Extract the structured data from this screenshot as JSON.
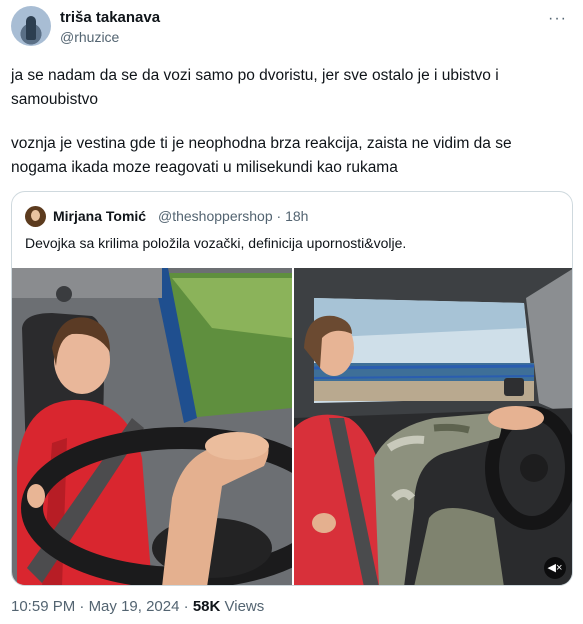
{
  "tweet": {
    "author_name": "triša takanava",
    "author_handle": "@rhuzice",
    "paragraphs": [
      "ja se nadam da se da vozi samo po dvoristu, jer sve ostalo je i ubistvo i samoubistvo",
      "voznja je vestina gde ti je neophodna brza reakcija, zaista ne vidim da se nogama ikada moze reagovati u milisekundi kao rukama"
    ],
    "more_icon": "more-horizontal-icon",
    "time": "10:59 PM",
    "separator": "·",
    "date": "May 19, 2024",
    "views_count": "58K",
    "views_label": "Views"
  },
  "quoted": {
    "author_name": "Mirjana Tomić",
    "author_handle": "@theshoppershop",
    "separator": "·",
    "age": "18h",
    "text": "Devojka sa krilima položila vozački, definicija upornosti&volje.",
    "media": [
      {
        "kind": "photo",
        "subject": "driver-steering-with-foot-interior"
      },
      {
        "kind": "video",
        "subject": "driver-steering-with-foot-side-view",
        "icon": "mute-icon"
      }
    ]
  },
  "colors": {
    "text_primary": "#0f1419",
    "text_secondary": "#536471",
    "border": "#cfd9de"
  }
}
